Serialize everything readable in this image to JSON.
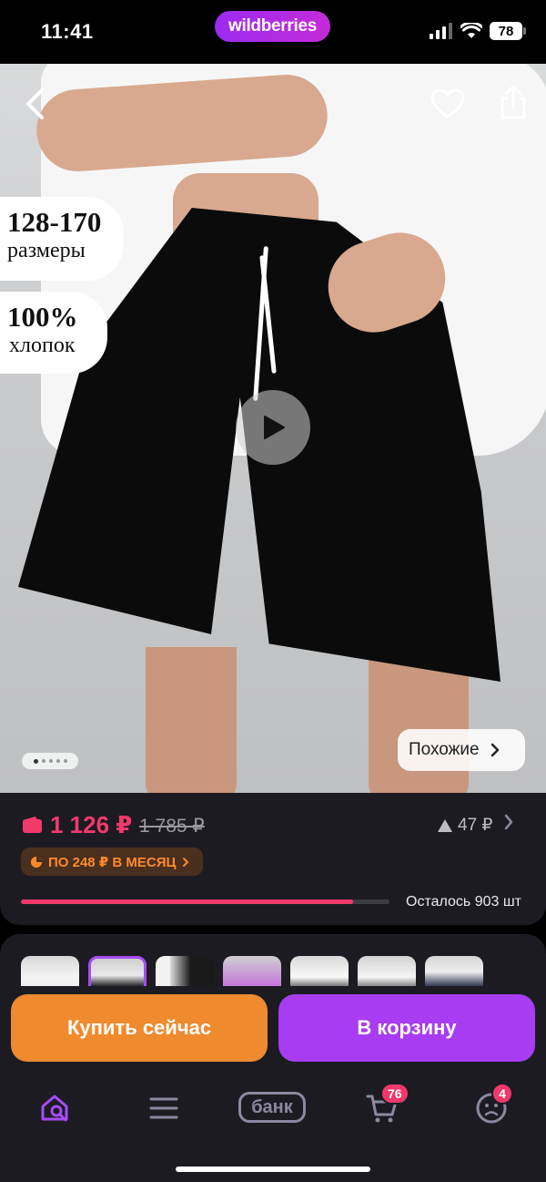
{
  "status_bar": {
    "time": "11:41",
    "brand": "wildberries",
    "battery": "78"
  },
  "hero": {
    "promo_sizes": {
      "big": "128-170",
      "small": "размеры"
    },
    "promo_cotton": {
      "big": "100%",
      "small": "хлопок"
    },
    "similar_label": "Похожие",
    "gallery_position": {
      "current": 1,
      "total": 5
    }
  },
  "price": {
    "current": "1 126 ₽",
    "old": "1 785 ₽",
    "delta": "47 ₽",
    "installment": "ПО 248 ₽ В МЕСЯЦ",
    "stock_text": "Осталось 903 шт",
    "stock_fraction": 0.9
  },
  "thumbnails": [
    {
      "name": "thumb-1",
      "selected": false
    },
    {
      "name": "thumb-2",
      "selected": true
    },
    {
      "name": "thumb-3",
      "selected": false
    },
    {
      "name": "thumb-4",
      "selected": false
    },
    {
      "name": "thumb-5",
      "selected": false
    },
    {
      "name": "thumb-6",
      "selected": false
    },
    {
      "name": "thumb-7",
      "selected": false
    }
  ],
  "actions": {
    "buy_now": "Купить сейчас",
    "add_to_cart": "В корзину"
  },
  "nav": {
    "bank_label": "банк",
    "cart_badge": "76",
    "profile_badge": "4"
  },
  "colors": {
    "accent_purple": "#a83cf2",
    "accent_orange": "#f08a2e",
    "price_pink": "#f23a6d",
    "card_bg": "#1c1b22"
  },
  "icons": [
    "back-icon",
    "heart-icon",
    "share-icon",
    "play-icon",
    "wallet-icon",
    "arrow-up-icon",
    "chevron-right-icon",
    "home-search-icon",
    "menu-icon",
    "cart-icon",
    "profile-icon"
  ]
}
